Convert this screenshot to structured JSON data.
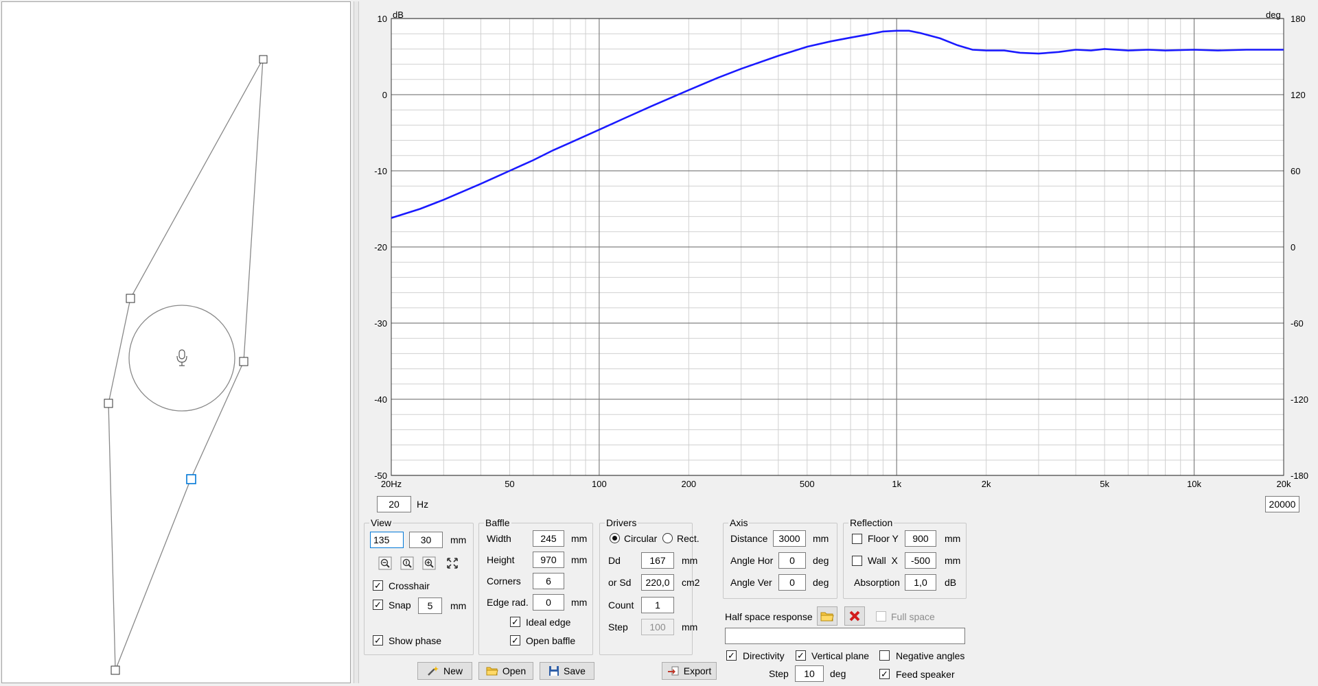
{
  "graph": {
    "left_unit": "dB",
    "right_unit": "deg",
    "left_ticks": [
      "10",
      "0",
      "-10",
      "-20",
      "-30",
      "-40",
      "-50"
    ],
    "right_ticks": [
      "180",
      "120",
      "60",
      "0",
      "-60",
      "-120",
      "-180"
    ],
    "x_ticks": [
      "20Hz",
      "50",
      "100",
      "200",
      "500",
      "1k",
      "2k",
      "5k",
      "10k",
      "20k"
    ],
    "curve_color": "#1a1aff"
  },
  "chart_data": {
    "type": "line",
    "xscale": "log",
    "xlim": [
      20,
      20000
    ],
    "ylim": [
      -50,
      10
    ],
    "y2lim": [
      -180,
      180
    ],
    "xlabel": "",
    "ylabel": "dB",
    "y2label": "deg",
    "grid": true,
    "series": [
      {
        "x": [
          20,
          25,
          30,
          40,
          50,
          60,
          70,
          80,
          100,
          120,
          150,
          200,
          250,
          300,
          400,
          500,
          600,
          700,
          800,
          900,
          1000,
          1100,
          1200,
          1400,
          1600,
          1800,
          2000,
          2300,
          2600,
          3000,
          3500,
          4000,
          4500,
          5000,
          6000,
          7000,
          8000,
          10000,
          12000,
          15000,
          20000
        ],
        "values": [
          -16.2,
          -15.0,
          -13.8,
          -11.7,
          -10.0,
          -8.6,
          -7.3,
          -6.3,
          -4.6,
          -3.2,
          -1.5,
          0.6,
          2.2,
          3.4,
          5.1,
          6.3,
          7.0,
          7.5,
          7.9,
          8.3,
          8.4,
          8.4,
          8.1,
          7.4,
          6.5,
          5.9,
          5.8,
          5.8,
          5.5,
          5.4,
          5.6,
          5.9,
          5.8,
          6.0,
          5.8,
          5.9,
          5.8,
          5.9,
          5.8,
          5.9,
          5.9
        ]
      }
    ]
  },
  "freq_range": {
    "min": "20",
    "hz_unit": "Hz",
    "max": "20000"
  },
  "view": {
    "title": "View",
    "x_value": "135",
    "y_value": "30",
    "unit": "mm",
    "crosshair_label": "Crosshair",
    "crosshair_checked": true,
    "snap_label": "Snap",
    "snap_checked": true,
    "snap_value": "5",
    "snap_unit": "mm",
    "show_phase_label": "Show phase",
    "show_phase_checked": true
  },
  "baffle": {
    "title": "Baffle",
    "width_label": "Width",
    "width_value": "245",
    "width_unit": "mm",
    "height_label": "Height",
    "height_value": "970",
    "height_unit": "mm",
    "corners_label": "Corners",
    "corners_value": "6",
    "edge_label": "Edge rad.",
    "edge_value": "0",
    "edge_unit": "mm",
    "ideal_edge_label": "Ideal edge",
    "ideal_edge_checked": true,
    "open_baffle_label": "Open baffle",
    "open_baffle_checked": true
  },
  "drivers": {
    "title": "Drivers",
    "circular_label": "Circular",
    "rect_label": "Rect.",
    "dd_label": "Dd",
    "dd_value": "167",
    "dd_unit": "mm",
    "sd_label": "or Sd",
    "sd_value": "220,0",
    "sd_unit": "cm2",
    "count_label": "Count",
    "count_value": "1",
    "step_label": "Step",
    "step_value": "100",
    "step_unit": "mm"
  },
  "axis": {
    "title": "Axis",
    "distance_label": "Distance",
    "distance_value": "3000",
    "distance_unit": "mm",
    "angle_hor_label": "Angle Hor",
    "angle_hor_value": "0",
    "angle_hor_unit": "deg",
    "angle_ver_label": "Angle Ver",
    "angle_ver_value": "0",
    "angle_ver_unit": "deg"
  },
  "reflection": {
    "title": "Reflection",
    "floor_label": "Floor Y",
    "floor_value": "900",
    "floor_unit": "mm",
    "floor_checked": false,
    "wall_label": "Wall  X",
    "wall_value": "-500",
    "wall_unit": "mm",
    "wall_checked": false,
    "absorption_label": "Absorption",
    "absorption_value": "1,0",
    "absorption_unit": "dB"
  },
  "half_space": {
    "label": "Half space response",
    "full_space_label": "Full space",
    "full_space_checked": false,
    "file_value": ""
  },
  "options": {
    "directivity_label": "Directivity",
    "directivity_checked": true,
    "vertical_plane_label": "Vertical plane",
    "vertical_plane_checked": true,
    "negative_angles_label": "Negative angles",
    "negative_angles_checked": false,
    "step_label": "Step",
    "step_value": "10",
    "step_unit": "deg",
    "feed_speaker_label": "Feed speaker",
    "feed_speaker_checked": true
  },
  "buttons": {
    "new": "New",
    "open": "Open",
    "save": "Save",
    "export": "Export"
  },
  "icons": {
    "zoom_out": "zoom-out-icon",
    "zoom_fit": "zoom-fit-icon",
    "zoom_in": "zoom-in-icon",
    "fullscreen": "fullscreen-icon",
    "new": "wand-icon",
    "open": "folder-icon",
    "save": "floppy-icon",
    "export": "export-icon",
    "half_open": "folder-icon",
    "half_delete": "delete-icon",
    "mic": "microphone-icon"
  },
  "check_glyph": "✓"
}
